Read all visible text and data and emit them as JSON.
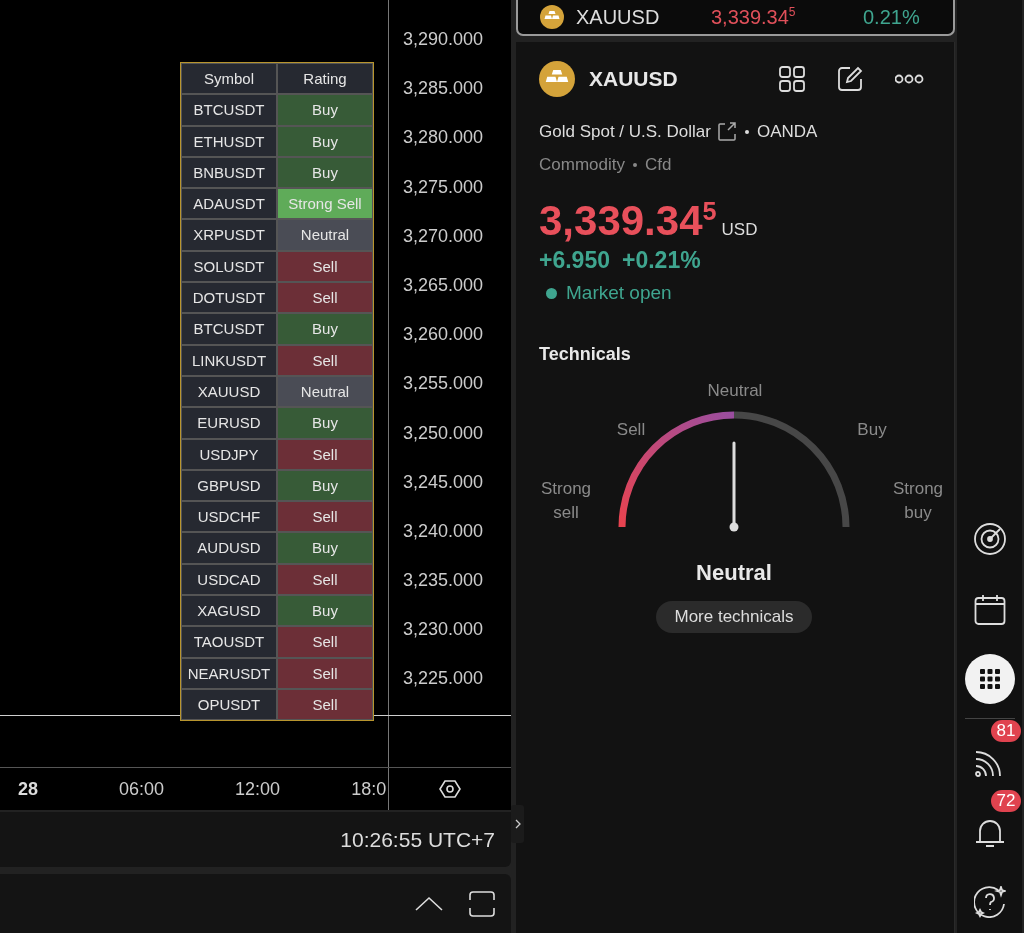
{
  "chart": {
    "price_axis": [
      "3,290.000",
      "3,285.000",
      "3,280.000",
      "3,275.000",
      "3,270.000",
      "3,265.000",
      "3,260.000",
      "3,255.000",
      "3,250.000",
      "3,245.000",
      "3,240.000",
      "3,235.000",
      "3,230.000",
      "3,225.000"
    ],
    "time_axis": [
      {
        "label": "28",
        "kind": "day"
      },
      {
        "label": "06:00",
        "kind": "time"
      },
      {
        "label": "12:00",
        "kind": "time"
      },
      {
        "label": "18:0",
        "kind": "time"
      }
    ],
    "rating_table": {
      "columns": [
        "Symbol",
        "Rating"
      ],
      "rows": [
        {
          "symbol": "BTCUSDT",
          "rating": "Buy",
          "color": "#375b37"
        },
        {
          "symbol": "ETHUSDT",
          "rating": "Buy",
          "color": "#375b37"
        },
        {
          "symbol": "BNBUSDT",
          "rating": "Buy",
          "color": "#375b37"
        },
        {
          "symbol": "ADAUSDT",
          "rating": "Strong Sell",
          "color": "#5fab59"
        },
        {
          "symbol": "XRPUSDT",
          "rating": "Neutral",
          "color": "#4a4c55"
        },
        {
          "symbol": "SOLUSDT",
          "rating": "Sell",
          "color": "#6c2f37"
        },
        {
          "symbol": "DOTUSDT",
          "rating": "Sell",
          "color": "#6c2f37"
        },
        {
          "symbol": "BTCUSDT",
          "rating": "Buy",
          "color": "#375b37"
        },
        {
          "symbol": "LINKUSDT",
          "rating": "Sell",
          "color": "#6c2f37"
        },
        {
          "symbol": "XAUUSD",
          "rating": "Neutral",
          "color": "#4a4c55"
        },
        {
          "symbol": "EURUSD",
          "rating": "Buy",
          "color": "#375b37"
        },
        {
          "symbol": "USDJPY",
          "rating": "Sell",
          "color": "#6c2f37"
        },
        {
          "symbol": "GBPUSD",
          "rating": "Buy",
          "color": "#375b37"
        },
        {
          "symbol": "USDCHF",
          "rating": "Sell",
          "color": "#6c2f37"
        },
        {
          "symbol": "AUDUSD",
          "rating": "Buy",
          "color": "#375b37"
        },
        {
          "symbol": "USDCAD",
          "rating": "Sell",
          "color": "#6c2f37"
        },
        {
          "symbol": "XAGUSD",
          "rating": "Buy",
          "color": "#375b37"
        },
        {
          "symbol": "TAOUSDT",
          "rating": "Sell",
          "color": "#6c2f37"
        },
        {
          "symbol": "NEARUSDT",
          "rating": "Sell",
          "color": "#6c2f37"
        },
        {
          "symbol": "OPUSDT",
          "rating": "Sell",
          "color": "#6c2f37"
        }
      ]
    }
  },
  "status_bar": {
    "time": "10:26:55 UTC+7"
  },
  "symbol_bar": {
    "symbol": "XAUUSD",
    "price": "3,339.34$^{5}$",
    "change": "0.21%"
  },
  "details": {
    "symbol": "XAUUSD",
    "name": "Gold Spot / U.S. Dollar",
    "exchange": "OANDA",
    "category": "Commodity",
    "type": "Cfd",
    "price": "3,339.34$^{5}$",
    "currency": "USD",
    "change": "+6.950",
    "change_percent": "+0.21%",
    "market_status": "Market open"
  },
  "technicals": {
    "title": "Technicals",
    "gauge": {
      "labels": [
        "Strong sell",
        "Sell",
        "Neutral",
        "Buy",
        "Strong buy"
      ],
      "level": 0.5
    },
    "result": "Neutral",
    "button": "More technicals"
  },
  "sidebar": {
    "top_items": [
      {
        "kind": "radar",
        "selected": false
      },
      {
        "kind": "calendar",
        "selected": false
      },
      {
        "kind": "apps",
        "selected": true
      }
    ],
    "bottom_items": [
      {
        "kind": "feed",
        "badge": "81"
      },
      {
        "kind": "bell",
        "badge": "72"
      },
      {
        "kind": "help"
      }
    ]
  }
}
